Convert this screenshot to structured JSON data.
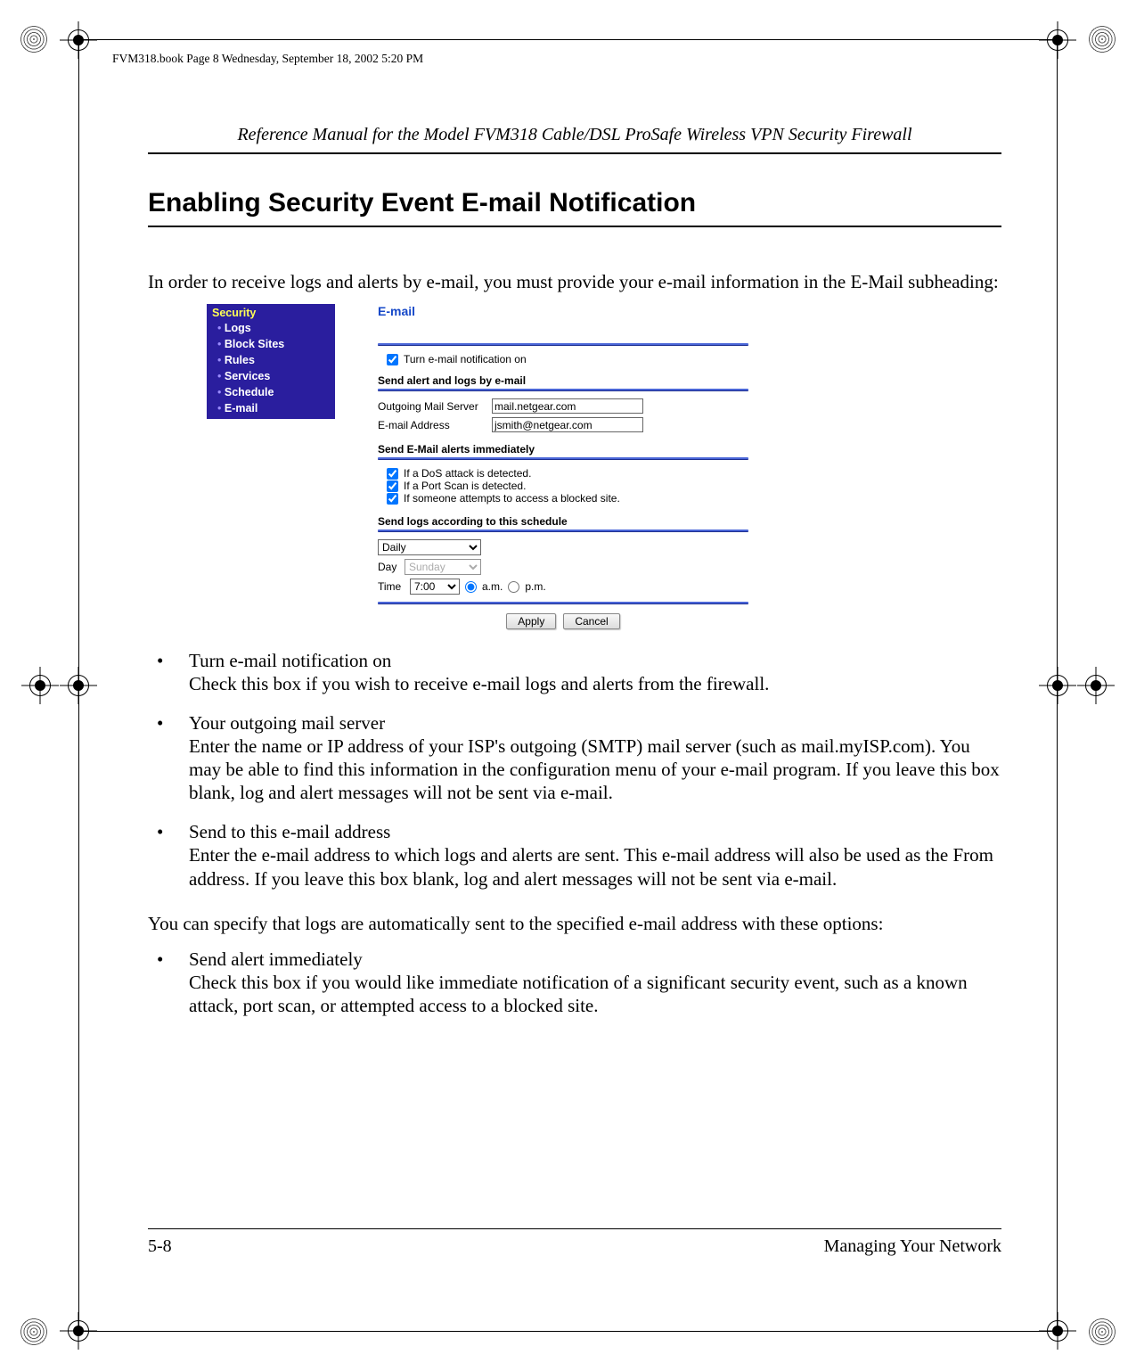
{
  "header_slug": "FVM318.book  Page 8  Wednesday, September 18, 2002  5:20 PM",
  "running_head": "Reference Manual for the Model FVM318 Cable/DSL ProSafe Wireless VPN Security Firewall",
  "section_title": "Enabling Security Event E-mail Notification",
  "intro": "In order to receive logs and alerts by e-mail, you must provide your e-mail information in the E-Mail subheading:",
  "sidebar": {
    "heading": "Security",
    "items": [
      "Logs",
      "Block Sites",
      "Rules",
      "Services",
      "Schedule",
      "E-mail"
    ]
  },
  "form": {
    "title": "E-mail",
    "turn_on_label": "Turn e-mail notification on",
    "group1": "Send alert and logs by e-mail",
    "outgoing_label": "Outgoing Mail Server",
    "outgoing_value": "mail.netgear.com",
    "email_label": "E-mail Address",
    "email_value": "jsmith@netgear.com",
    "group2": "Send E-Mail alerts immediately",
    "alert1": "If a DoS attack is detected.",
    "alert2": "If a Port Scan is detected.",
    "alert3": "If someone attempts to access a blocked site.",
    "group3": "Send logs according to this schedule",
    "schedule_value": "Daily",
    "day_label": "Day",
    "day_value": "Sunday",
    "time_label": "Time",
    "time_value": "7:00",
    "am_label": "a.m.",
    "pm_label": "p.m.",
    "apply": "Apply",
    "cancel": "Cancel"
  },
  "bullets_a": [
    {
      "lead": "Turn e-mail notification on",
      "body": "Check this box if you wish to receive e-mail logs and alerts from the firewall."
    },
    {
      "lead": "Your outgoing mail server",
      "body": "Enter the name or IP address of your ISP's outgoing (SMTP) mail server (such as mail.myISP.com). You may be able to find this information in the configuration menu of your e-mail program. If you leave this box blank, log and alert messages will not be sent via e-mail."
    },
    {
      "lead": "Send to this e-mail address",
      "body": "Enter the e-mail address to which logs and alerts are sent. This e-mail address will also be used as the From address. If you leave this box blank, log and alert messages will not be sent via e-mail."
    }
  ],
  "mid_para": "You can specify that logs are automatically sent to the specified e-mail address with these options:",
  "bullets_b": [
    {
      "lead": "Send alert immediately",
      "body": "Check this box if you would like immediate notification of a significant security event, such as a known attack, port scan, or attempted access to a blocked site."
    }
  ],
  "footer": {
    "left": "5-8",
    "right": "Managing Your Network"
  }
}
